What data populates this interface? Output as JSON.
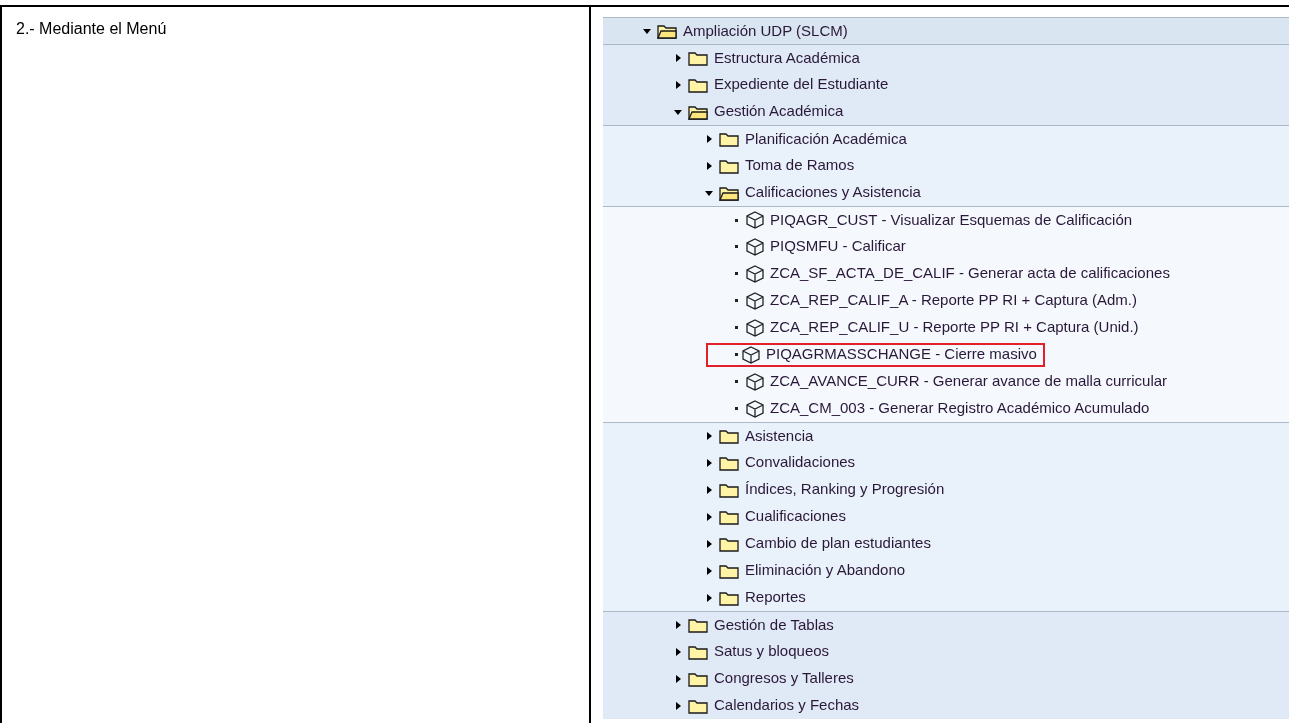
{
  "document": {
    "step_text": "2.- Mediante el Menú"
  },
  "tree": [
    {
      "kind": "folder",
      "label": "Ampliación UDP (SLCM)",
      "expanded": true,
      "children": [
        {
          "kind": "folder",
          "label": "Estructura Académica",
          "expanded": false
        },
        {
          "kind": "folder",
          "label": "Expediente del Estudiante",
          "expanded": false
        },
        {
          "kind": "folder",
          "label": "Gestión Académica",
          "expanded": true,
          "children": [
            {
              "kind": "folder",
              "label": "Planificación Académica",
              "expanded": false
            },
            {
              "kind": "folder",
              "label": "Toma de Ramos",
              "expanded": false
            },
            {
              "kind": "folder",
              "label": "Calificaciones y Asistencia",
              "expanded": true,
              "children": [
                {
                  "kind": "transaction",
                  "label": "PIQAGR_CUST - Visualizar Esquemas de Calificación",
                  "highlighted": false
                },
                {
                  "kind": "transaction",
                  "label": "PIQSMFU - Calificar",
                  "highlighted": false
                },
                {
                  "kind": "transaction",
                  "label": "ZCA_SF_ACTA_DE_CALIF - Generar acta de calificaciones",
                  "highlighted": false
                },
                {
                  "kind": "transaction",
                  "label": "ZCA_REP_CALIF_A - Reporte  PP RI + Captura (Adm.)",
                  "highlighted": false
                },
                {
                  "kind": "transaction",
                  "label": "ZCA_REP_CALIF_U - Reporte  PP RI + Captura (Unid.)",
                  "highlighted": false
                },
                {
                  "kind": "transaction",
                  "label": "PIQAGRMASSCHANGE - Cierre masivo",
                  "highlighted": true
                },
                {
                  "kind": "transaction",
                  "label": "ZCA_AVANCE_CURR - Generar avance de malla curricular",
                  "highlighted": false
                },
                {
                  "kind": "transaction",
                  "label": "ZCA_CM_003 - Generar Registro Académico Acumulado",
                  "highlighted": false
                }
              ]
            },
            {
              "kind": "folder",
              "label": "Asistencia",
              "expanded": false
            },
            {
              "kind": "folder",
              "label": "Convalidaciones",
              "expanded": false
            },
            {
              "kind": "folder",
              "label": "Índices, Ranking y Progresión",
              "expanded": false
            },
            {
              "kind": "folder",
              "label": "Cualificaciones",
              "expanded": false
            },
            {
              "kind": "folder",
              "label": "Cambio de plan estudiantes",
              "expanded": false
            },
            {
              "kind": "folder",
              "label": "Eliminación y Abandono",
              "expanded": false
            },
            {
              "kind": "folder",
              "label": "Reportes",
              "expanded": false
            }
          ]
        },
        {
          "kind": "folder",
          "label": "Gestión de Tablas",
          "expanded": false
        },
        {
          "kind": "folder",
          "label": "Satus y bloqueos",
          "expanded": false
        },
        {
          "kind": "folder",
          "label": "Congresos y Talleres",
          "expanded": false
        },
        {
          "kind": "folder",
          "label": "Calendarios y Fechas",
          "expanded": false
        }
      ]
    }
  ]
}
